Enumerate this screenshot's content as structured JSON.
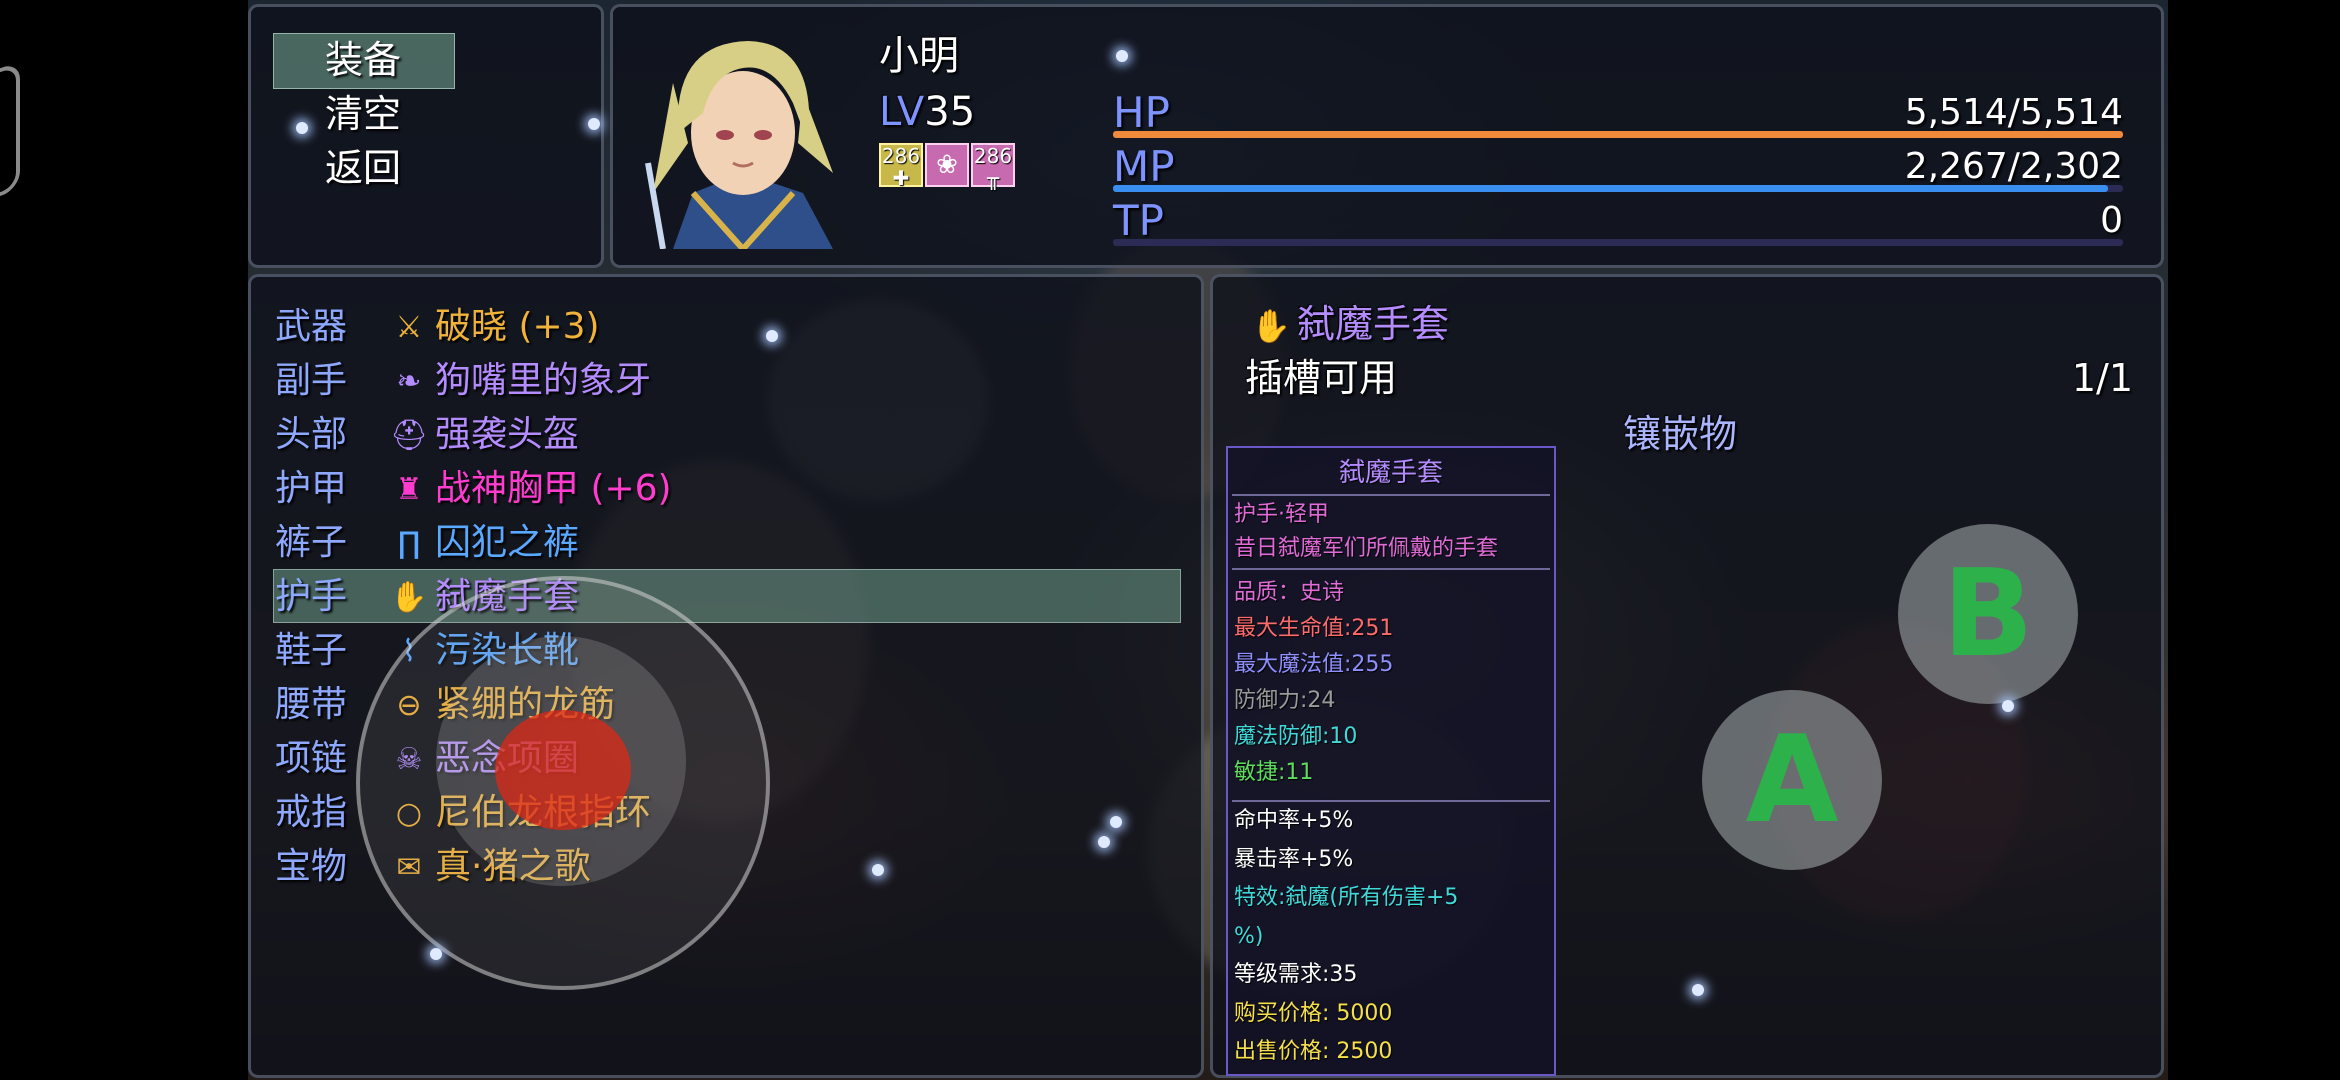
{
  "commands": [
    {
      "label": "装备",
      "selected": true
    },
    {
      "label": "清空",
      "selected": false
    },
    {
      "label": "返回",
      "selected": false
    }
  ],
  "actor": {
    "name": "小明",
    "level_prefix": "LV",
    "level": "35",
    "states": [
      {
        "icon": "shield-buff-icon",
        "turns": "286",
        "color": "#c8b84a"
      },
      {
        "icon": "spirit-buff-icon",
        "turns": "",
        "color": "#c86ab0"
      },
      {
        "icon": "weapon-buff-icon",
        "turns": "286",
        "color": "#c86ab0"
      }
    ],
    "hp": {
      "label": "HP",
      "value": "5,514/5,514",
      "fraction": 1.0
    },
    "mp": {
      "label": "MP",
      "value": "2,267/2,302",
      "fraction": 0.985
    },
    "tp": {
      "label": "TP",
      "value": "0",
      "fraction": 0.0
    }
  },
  "equipment": [
    {
      "slot": "武器",
      "icon": "sword-icon",
      "glyph": "⚔",
      "name": "破晓 (+3)",
      "color": "#f0b23a"
    },
    {
      "slot": "副手",
      "icon": "tusk-icon",
      "glyph": "❧",
      "name": "狗嘴里的象牙",
      "color": "#b48cff"
    },
    {
      "slot": "头部",
      "icon": "helmet-icon",
      "glyph": "⛑",
      "name": "强袭头盔",
      "color": "#b48cff"
    },
    {
      "slot": "护甲",
      "icon": "armor-icon",
      "glyph": "♜",
      "name": "战神胸甲 (+6)",
      "color": "#ff3ccf"
    },
    {
      "slot": "裤子",
      "icon": "pants-icon",
      "glyph": "∏",
      "name": "囚犯之裤",
      "color": "#5aa8ff"
    },
    {
      "slot": "护手",
      "icon": "glove-icon",
      "glyph": "✋",
      "name": "弑魔手套",
      "color": "#b48cff"
    },
    {
      "slot": "鞋子",
      "icon": "boots-icon",
      "glyph": "⌇",
      "name": "污染长靴",
      "color": "#5aa8ff"
    },
    {
      "slot": "腰带",
      "icon": "belt-icon",
      "glyph": "⊖",
      "name": "紧绷的龙筋",
      "color": "#f0b23a"
    },
    {
      "slot": "项链",
      "icon": "necklace-icon",
      "glyph": "☠",
      "name": "恶念项圈",
      "color": "#b48cff"
    },
    {
      "slot": "戒指",
      "icon": "ring-icon",
      "glyph": "○",
      "name": "尼伯龙根指环",
      "color": "#f0b23a"
    },
    {
      "slot": "宝物",
      "icon": "scroll-icon",
      "glyph": "✉",
      "name": "真·猪之歌",
      "color": "#f0b23a"
    }
  ],
  "selected_slot_index": 5,
  "detail": {
    "item_name": "弑魔手套",
    "slot_label": "插槽可用",
    "slot_count": "1/1",
    "socket_header": "镶嵌物"
  },
  "tooltip": {
    "title": "弑魔手套",
    "lines_a": [
      {
        "text": "护手·轻甲",
        "color": "#e06bd6"
      },
      {
        "text": "昔日弑魔军们所佩戴的手套",
        "color": "#e06bd6"
      }
    ],
    "lines_b": [
      {
        "text": "品质：史诗",
        "color": "#e06bd6"
      },
      {
        "text": "最大生命值:251",
        "color": "#ff6b6b"
      },
      {
        "text": "最大魔法值:255",
        "color": "#8f8fff"
      },
      {
        "text": "防御力:24",
        "color": "#9a9a9a"
      },
      {
        "text": "魔法防御:10",
        "color": "#3fd9d9"
      },
      {
        "text": "敏捷:11",
        "color": "#5ddc5d"
      }
    ],
    "lines_c": [
      {
        "text": "命中率+5%",
        "color": "#ffffff"
      },
      {
        "text": "暴击率+5%",
        "color": "#ffffff"
      },
      {
        "text": "特效:弑魔(所有伤害+5",
        "color": "#3fd9d9"
      },
      {
        "text": "%)",
        "color": "#3fd9d9"
      },
      {
        "text": "等级需求:35",
        "color": "#ffffff"
      },
      {
        "text": "购买价格: 5000",
        "color": "#f5e04a"
      },
      {
        "text": "出售价格: 2500",
        "color": "#f5e04a"
      }
    ]
  },
  "virtual_buttons": {
    "a_label": "A",
    "b_label": "B"
  },
  "colors": {
    "hp_bar": "#f08a3a",
    "mp_bar": "#3a8ef0",
    "tp_bar": "#3a3a70",
    "selection": "#78aa96"
  }
}
